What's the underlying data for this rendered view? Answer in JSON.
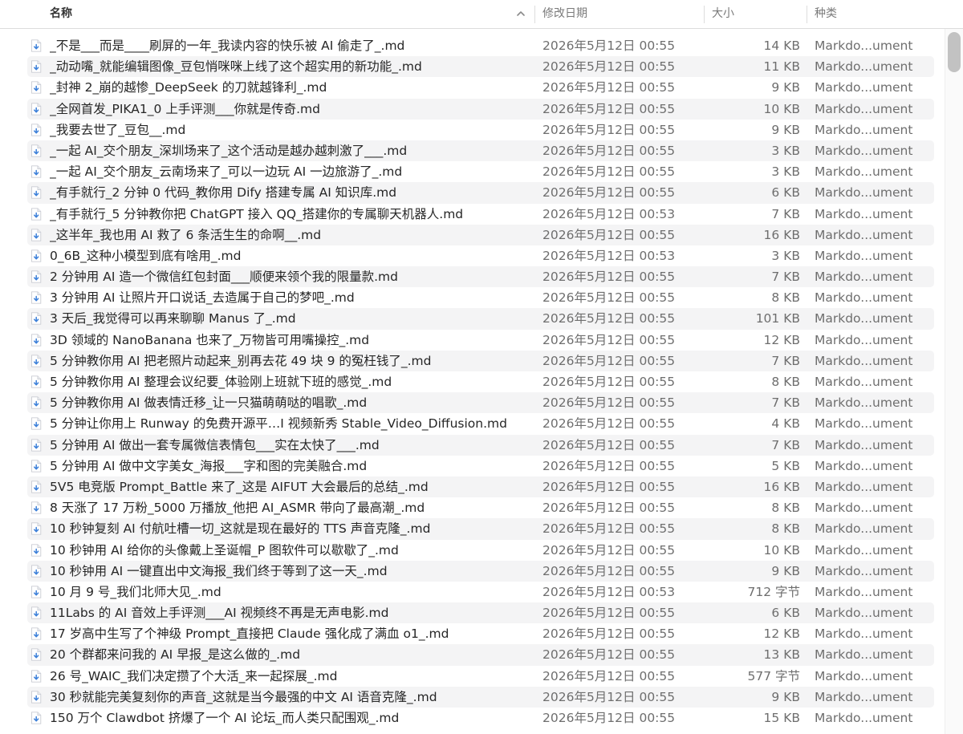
{
  "header": {
    "name": "名称",
    "date": "修改日期",
    "size": "大小",
    "kind": "种类"
  },
  "files": [
    {
      "name": "_不是___而是____刷屏的一年_我读内容的快乐被 AI 偷走了_.md",
      "date": "2026年5月12日 00:55",
      "size": "14 KB",
      "kind": "Markdo...ument"
    },
    {
      "name": "_动动嘴_就能编辑图像_豆包悄咪咪上线了这个超实用的新功能_.md",
      "date": "2026年5月12日 00:55",
      "size": "11 KB",
      "kind": "Markdo...ument"
    },
    {
      "name": "_封神 2_崩的越惨_DeepSeek 的刀就越锋利_.md",
      "date": "2026年5月12日 00:55",
      "size": "9 KB",
      "kind": "Markdo...ument"
    },
    {
      "name": "_全网首发_PIKA1_0 上手评测___你就是传奇.md",
      "date": "2026年5月12日 00:55",
      "size": "10 KB",
      "kind": "Markdo...ument"
    },
    {
      "name": "_我要去世了_豆包__.md",
      "date": "2026年5月12日 00:55",
      "size": "9 KB",
      "kind": "Markdo...ument"
    },
    {
      "name": "_一起 AI_交个朋友_深圳场来了_这个活动是越办越刺激了___.md",
      "date": "2026年5月12日 00:55",
      "size": "3 KB",
      "kind": "Markdo...ument"
    },
    {
      "name": "_一起 AI_交个朋友_云南场来了_可以一边玩 AI 一边旅游了_.md",
      "date": "2026年5月12日 00:55",
      "size": "3 KB",
      "kind": "Markdo...ument"
    },
    {
      "name": "_有手就行_2 分钟 0 代码_教你用 Dify 搭建专属 AI 知识库.md",
      "date": "2026年5月12日 00:55",
      "size": "6 KB",
      "kind": "Markdo...ument"
    },
    {
      "name": "_有手就行_5 分钟教你把 ChatGPT 接入 QQ_搭建你的专属聊天机器人.md",
      "date": "2026年5月12日 00:53",
      "size": "7 KB",
      "kind": "Markdo...ument"
    },
    {
      "name": "_这半年_我也用 AI 救了 6 条活生生的命啊__.md",
      "date": "2026年5月12日 00:55",
      "size": "16 KB",
      "kind": "Markdo...ument"
    },
    {
      "name": "0_6B_这种小模型到底有啥用_.md",
      "date": "2026年5月12日 00:53",
      "size": "3 KB",
      "kind": "Markdo...ument"
    },
    {
      "name": "2 分钟用 AI 造一个微信红包封面___顺便来领个我的限量款.md",
      "date": "2026年5月12日 00:55",
      "size": "7 KB",
      "kind": "Markdo...ument"
    },
    {
      "name": "3 分钟用 AI 让照片开口说话_去造属于自己的梦吧_.md",
      "date": "2026年5月12日 00:55",
      "size": "8 KB",
      "kind": "Markdo...ument"
    },
    {
      "name": "3 天后_我觉得可以再来聊聊 Manus 了_.md",
      "date": "2026年5月12日 00:55",
      "size": "101 KB",
      "kind": "Markdo...ument"
    },
    {
      "name": "3D 领域的 NanoBanana 也来了_万物皆可用嘴操控_.md",
      "date": "2026年5月12日 00:55",
      "size": "12 KB",
      "kind": "Markdo...ument"
    },
    {
      "name": "5 分钟教你用 AI 把老照片动起来_别再去花 49 块 9 的冤枉钱了_.md",
      "date": "2026年5月12日 00:55",
      "size": "7 KB",
      "kind": "Markdo...ument"
    },
    {
      "name": "5 分钟教你用 AI 整理会议纪要_体验刚上班就下班的感觉_.md",
      "date": "2026年5月12日 00:55",
      "size": "8 KB",
      "kind": "Markdo...ument"
    },
    {
      "name": "5 分钟教你用 AI 做表情迁移_让一只猫萌萌哒的唱歌_.md",
      "date": "2026年5月12日 00:55",
      "size": "7 KB",
      "kind": "Markdo...ument"
    },
    {
      "name": "5 分钟让你用上 Runway 的免费开源平…I 视频新秀 Stable_Video_Diffusion.md",
      "date": "2026年5月12日 00:55",
      "size": "4 KB",
      "kind": "Markdo...ument"
    },
    {
      "name": "5 分钟用 AI 做出一套专属微信表情包___实在太快了___.md",
      "date": "2026年5月12日 00:55",
      "size": "7 KB",
      "kind": "Markdo...ument"
    },
    {
      "name": "5 分钟用 AI 做中文字美女_海报___字和图的完美融合.md",
      "date": "2026年5月12日 00:55",
      "size": "5 KB",
      "kind": "Markdo...ument"
    },
    {
      "name": "5V5 电竞版 Prompt_Battle 来了_这是 AIFUT 大会最后的总结_.md",
      "date": "2026年5月12日 00:55",
      "size": "16 KB",
      "kind": "Markdo...ument"
    },
    {
      "name": "8 天涨了 17 万粉_5000 万播放_他把 AI_ASMR 带向了最高潮_.md",
      "date": "2026年5月12日 00:55",
      "size": "8 KB",
      "kind": "Markdo...ument"
    },
    {
      "name": "10 秒钟复刻 AI 付航吐槽一切_这就是现在最好的 TTS 声音克隆_.md",
      "date": "2026年5月12日 00:55",
      "size": "8 KB",
      "kind": "Markdo...ument"
    },
    {
      "name": "10 秒钟用 AI 给你的头像戴上圣诞帽_P 图软件可以歇歇了_.md",
      "date": "2026年5月12日 00:55",
      "size": "10 KB",
      "kind": "Markdo...ument"
    },
    {
      "name": "10 秒钟用 AI 一键直出中文海报_我们终于等到了这一天_.md",
      "date": "2026年5月12日 00:55",
      "size": "9 KB",
      "kind": "Markdo...ument"
    },
    {
      "name": "10 月 9 号_我们北师大见_.md",
      "date": "2026年5月12日 00:53",
      "size": "712 字节",
      "kind": "Markdo...ument"
    },
    {
      "name": "11Labs 的 AI 音效上手评测___AI 视频终不再是无声电影.md",
      "date": "2026年5月12日 00:55",
      "size": "6 KB",
      "kind": "Markdo...ument"
    },
    {
      "name": "17 岁高中生写了个神级 Prompt_直接把 Claude 强化成了满血 o1_.md",
      "date": "2026年5月12日 00:55",
      "size": "12 KB",
      "kind": "Markdo...ument"
    },
    {
      "name": "20 个群都来问我的 AI 早报_是这么做的_.md",
      "date": "2026年5月12日 00:55",
      "size": "13 KB",
      "kind": "Markdo...ument"
    },
    {
      "name": "26 号_WAIC_我们决定攒了个大活_来一起探展_.md",
      "date": "2026年5月12日 00:55",
      "size": "577 字节",
      "kind": "Markdo...ument"
    },
    {
      "name": "30 秒就能完美复刻你的声音_这就是当今最强的中文 AI 语音克隆_.md",
      "date": "2026年5月12日 00:55",
      "size": "9 KB",
      "kind": "Markdo...ument"
    },
    {
      "name": "150 万个 Clawdbot 挤爆了一个 AI 论坛_而人类只配围观_.md",
      "date": "2026年5月12日 00:55",
      "size": "15 KB",
      "kind": "Markdo...ument"
    }
  ]
}
